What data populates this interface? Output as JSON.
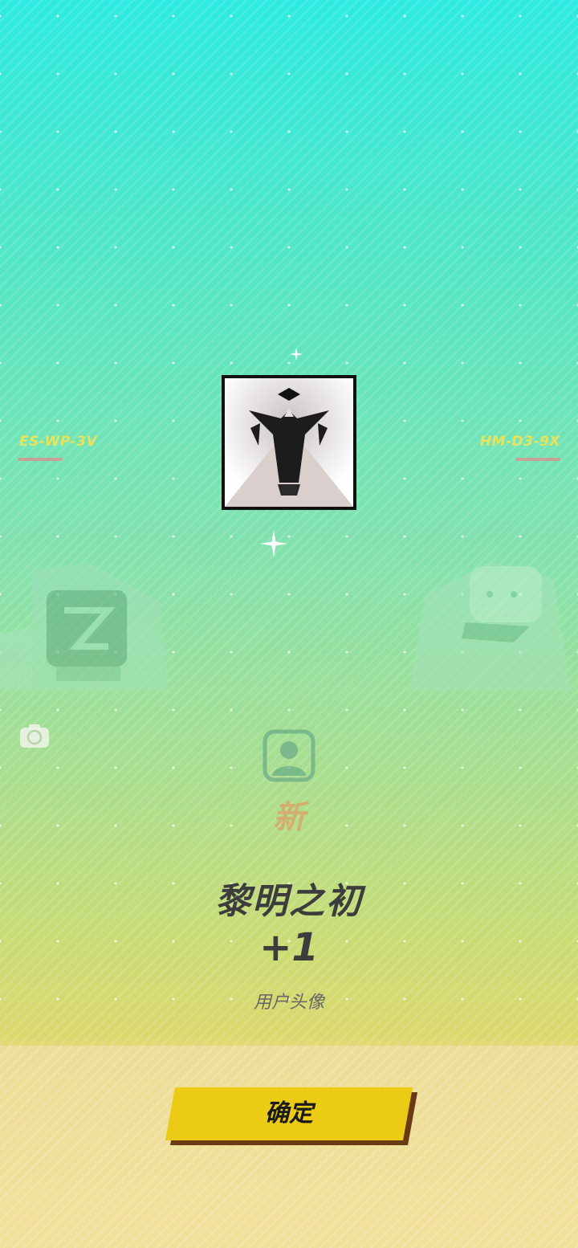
{
  "side_codes": {
    "left": "ES-WP-3V",
    "right": "HM-D3-9X"
  },
  "reward": {
    "avatar_icon": "dawn-emblem-avatar",
    "new_badge": "新",
    "name": "黎明之初",
    "count": "+1",
    "type": "用户头像"
  },
  "icons": {
    "camera": "camera-icon",
    "avatar_type": "user-avatar-icon",
    "sparkle": "sparkle-icon"
  },
  "confirm_button": {
    "label": "确定"
  },
  "colors": {
    "top_gradient": "#2eeae0",
    "middle_gradient": "#a9de8f",
    "lower_gradient": "#dcd86e",
    "bottom_panel": "#f0e19a",
    "button_yellow": "#ebcb13",
    "button_shadow": "#6a3a12",
    "side_code_text": "#e8e35a",
    "new_badge": "#e39a63",
    "title_text": "#3d3d3d"
  }
}
